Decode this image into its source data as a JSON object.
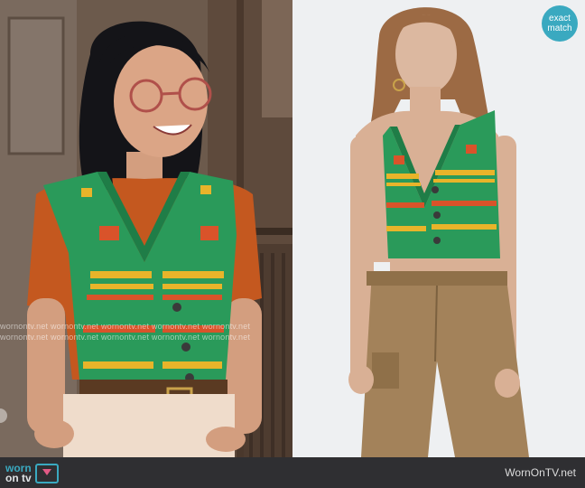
{
  "watermark_text": "wornontv.net",
  "badge": {
    "line1": "exact",
    "line2": "match"
  },
  "footer": {
    "logo_word1": "worn",
    "logo_word2": "on tv",
    "site": "WornOnTV.net"
  },
  "colors": {
    "vest_green": "#2a9a5a",
    "stripe_orange": "#d9532a",
    "stripe_yellow": "#e8b42a",
    "tee_rust": "#c4581f",
    "pants_khaki": "#a3825a",
    "badge_blue": "#3aa9c0"
  }
}
